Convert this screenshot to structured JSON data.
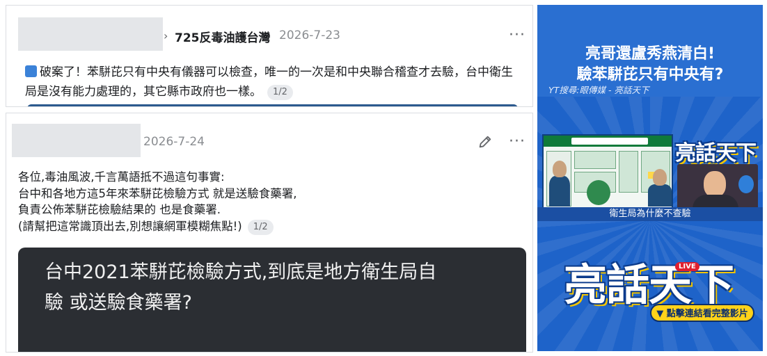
{
  "post1": {
    "chevron": "›",
    "group_name": "725反毒油護台灣",
    "date": "2026-7-23",
    "more": "···",
    "text": "破案了！苯駢芘只有中央有儀器可以檢查，唯一的一次是和中央聯合稽查才去驗，台中衛生局是沒有能力處理的，其它縣市政府也一樣。",
    "pager": "1/2"
  },
  "post2": {
    "date": "2026-7-24",
    "more": "···",
    "lines": [
      "各位,毒油風波,千言萬語抵不過這句事實:",
      "台中和各地方這5年來苯駢芘檢驗方式 就是送驗食藥署,",
      "負責公佈苯駢芘檢驗結果的 也是食藥署.",
      "(請幫把這常識頂出去,別想讓網軍模糊焦點!)"
    ],
    "pager": "1/2",
    "image_text_line1": "台中2021苯駢芘檢驗方式,到底是地方衛生局自",
    "image_text_line2": "驗 或送驗食藥署?"
  },
  "ad": {
    "title_line1": "亮哥還盧秀燕清白!",
    "title_line2": "驗苯駢芘只有中央有?",
    "subtitle": "YT搜尋:眼傳媒 - 亮話天下",
    "brand": "亮話天下",
    "live": "LIVE",
    "caption": "衛生局為什麼不查驗",
    "cta": "▼ 點擊連結看完整影片"
  }
}
